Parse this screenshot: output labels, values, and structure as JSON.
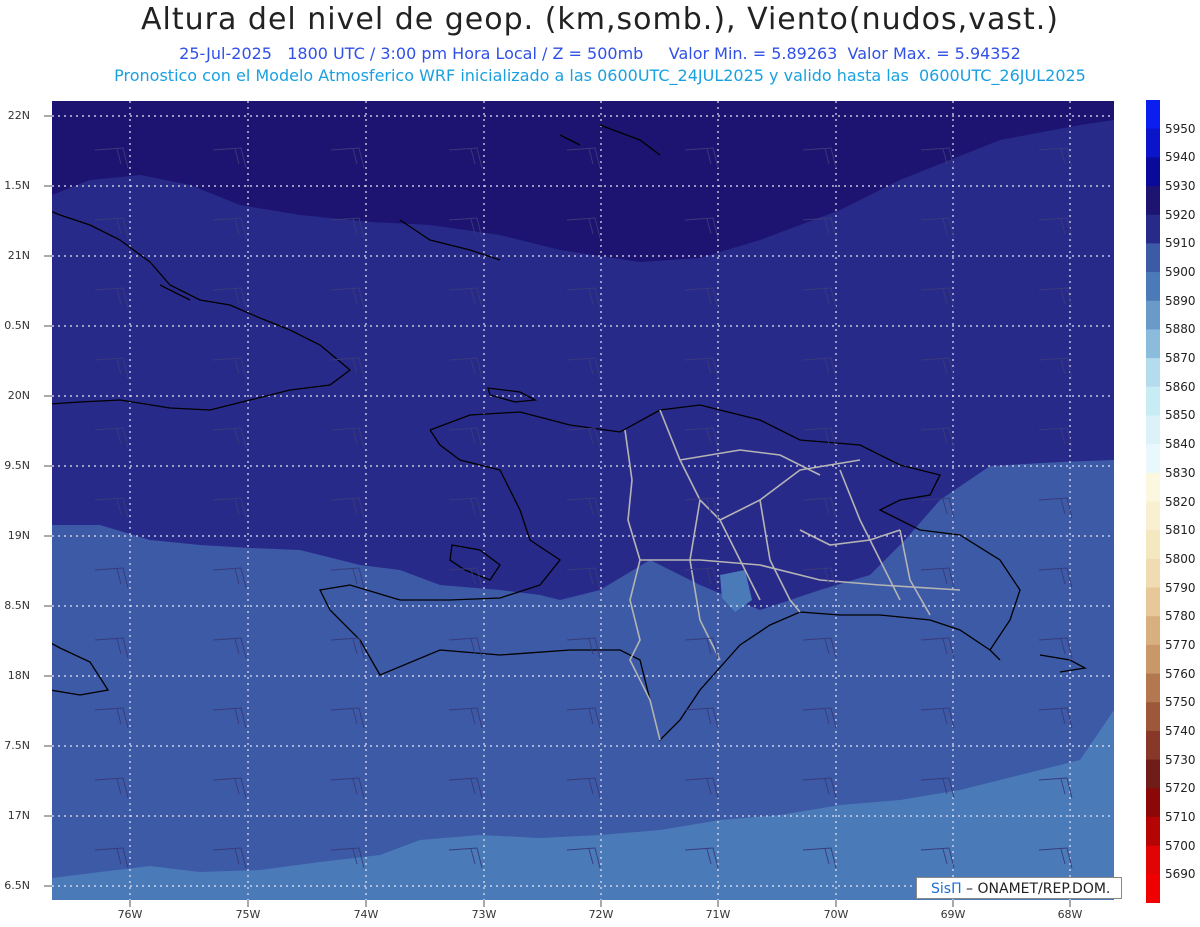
{
  "title": "Altura del nivel de geop. (km,somb.), Viento(nudos,vast.)",
  "subtitle1": "25-Jul-2025   1800 UTC / 3:00 pm Hora Local / Z = 500mb     Valor Min. = 5.89263  Valor Max. = 5.94352",
  "subtitle2": "Pronostico con el Modelo Atmosferico WRF inicializado a las 0600UTC_24JUL2025 y valido hasta las  0600UTC_26JUL2025",
  "lat_labels": [
    "22N",
    "1.5N",
    "21N",
    "0.5N",
    "20N",
    "9.5N",
    "19N",
    "8.5N",
    "18N",
    "7.5N",
    "17N",
    "6.5N"
  ],
  "lon_labels": [
    "76W",
    "75W",
    "74W",
    "73W",
    "72W",
    "71W",
    "70W",
    "69W",
    "68W"
  ],
  "colorbar": {
    "labels": [
      "5950",
      "5940",
      "5930",
      "5920",
      "5910",
      "5900",
      "5890",
      "5880",
      "5870",
      "5860",
      "5850",
      "5840",
      "5830",
      "5820",
      "5810",
      "5800",
      "5790",
      "5780",
      "5770",
      "5760",
      "5750",
      "5740",
      "5730",
      "5720",
      "5710",
      "5700",
      "5690"
    ],
    "colors": [
      "#0a1ef0",
      "#0a14c8",
      "#0a0a9a",
      "#1c1470",
      "#282a8a",
      "#3c5aa6",
      "#4a7ab8",
      "#6a9ac8",
      "#8cbcdc",
      "#b4dcec",
      "#c8ecf4",
      "#dcf2f8",
      "#e8f8fc",
      "#fcf8e0",
      "#f8f0d0",
      "#f4e8c0",
      "#f0dcb0",
      "#e8c898",
      "#d8b080",
      "#c89868",
      "#b47850",
      "#9c5838",
      "#883828",
      "#701c18",
      "#8c0808",
      "#b40404",
      "#e00404"
    ]
  },
  "field_colors": {
    "z5920": "#1c1470",
    "z5910": "#282a8a",
    "z5900": "#3c5aa6",
    "z5890": "#4a7ab8",
    "coast": "#000000",
    "borders": "#b4b4b4"
  },
  "credit": {
    "logo": "SisΠ",
    "text": " – ONAMET/REP.DOM."
  }
}
